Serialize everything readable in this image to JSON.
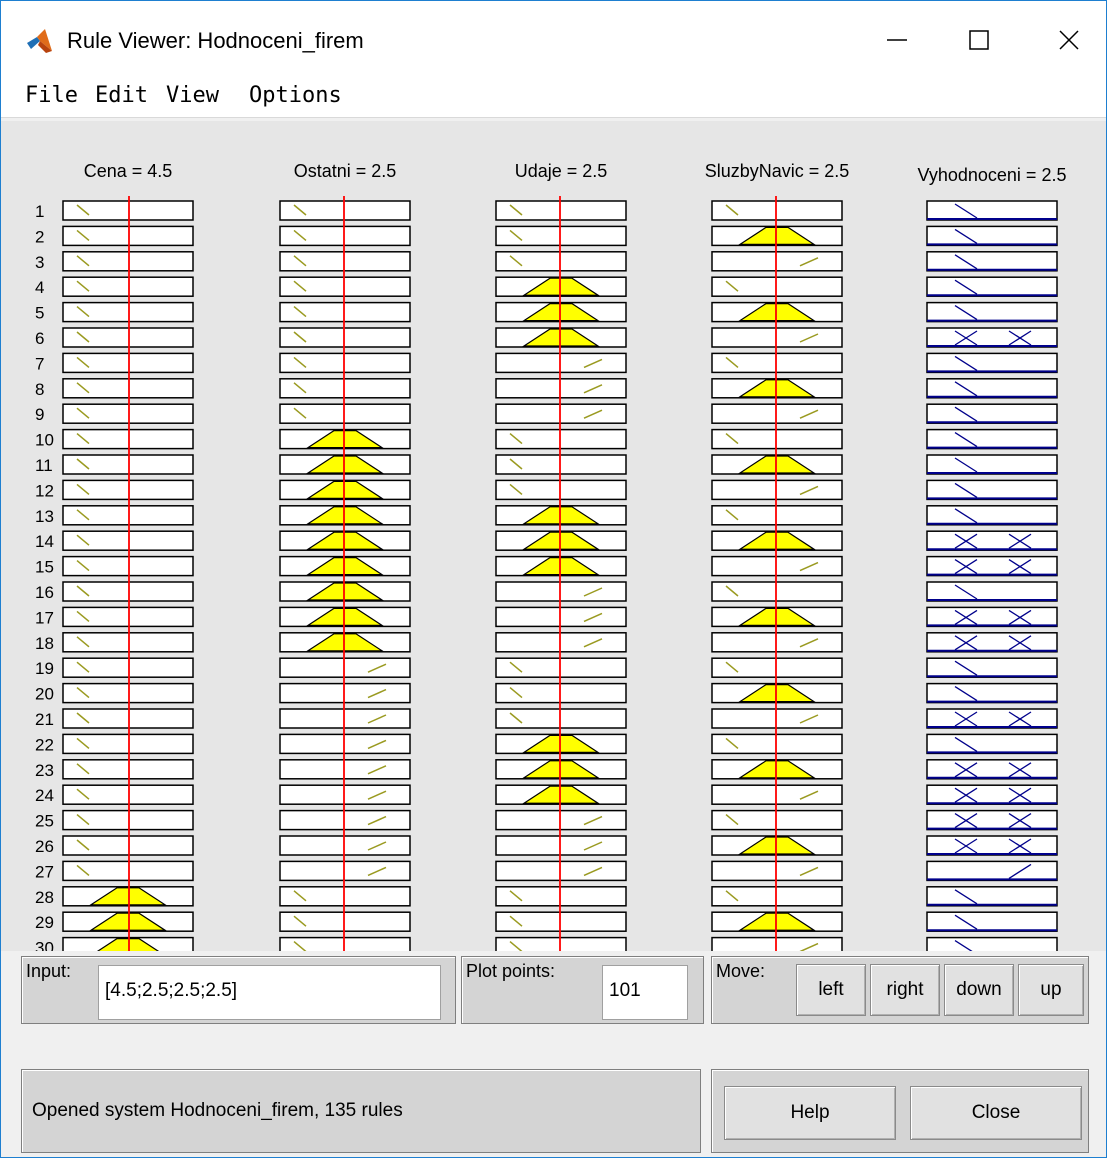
{
  "window": {
    "title": "Rule Viewer: Hodnoceni_firem",
    "controls": {
      "minimize": "minimize-icon",
      "maximize": "maximize-icon",
      "close": "close-icon"
    }
  },
  "menu": [
    "File",
    "Edit",
    "View",
    "Options"
  ],
  "columns": [
    {
      "label": "Cena = 4.5",
      "type": "input"
    },
    {
      "label": "Ostatni = 2.5",
      "type": "input"
    },
    {
      "label": "Udaje = 2.5",
      "type": "input"
    },
    {
      "label": "SluzbyNavic = 2.5",
      "type": "input"
    },
    {
      "label": "Vyhodnoceni = 2.5",
      "type": "output"
    }
  ],
  "rules": [
    {
      "number": "1",
      "mf": [
        "L",
        "L",
        "L",
        "L",
        "L"
      ]
    },
    {
      "number": "2",
      "mf": [
        "L",
        "L",
        "L",
        "M",
        "L"
      ]
    },
    {
      "number": "3",
      "mf": [
        "L",
        "L",
        "L",
        "H",
        "L"
      ]
    },
    {
      "number": "4",
      "mf": [
        "L",
        "L",
        "M",
        "L",
        "L"
      ]
    },
    {
      "number": "5",
      "mf": [
        "L",
        "L",
        "M",
        "M",
        "L"
      ]
    },
    {
      "number": "6",
      "mf": [
        "L",
        "L",
        "M",
        "H",
        "MLH"
      ]
    },
    {
      "number": "7",
      "mf": [
        "L",
        "L",
        "H",
        "L",
        "L"
      ]
    },
    {
      "number": "8",
      "mf": [
        "L",
        "L",
        "H",
        "M",
        "L"
      ]
    },
    {
      "number": "9",
      "mf": [
        "L",
        "L",
        "H",
        "H",
        "L"
      ]
    },
    {
      "number": "10",
      "mf": [
        "L",
        "M",
        "L",
        "L",
        "L"
      ]
    },
    {
      "number": "11",
      "mf": [
        "L",
        "M",
        "L",
        "M",
        "L"
      ]
    },
    {
      "number": "12",
      "mf": [
        "L",
        "M",
        "L",
        "H",
        "L"
      ]
    },
    {
      "number": "13",
      "mf": [
        "L",
        "M",
        "M",
        "L",
        "L"
      ]
    },
    {
      "number": "14",
      "mf": [
        "L",
        "M",
        "M",
        "M",
        "MLH"
      ]
    },
    {
      "number": "15",
      "mf": [
        "L",
        "M",
        "M",
        "H",
        "MLH"
      ]
    },
    {
      "number": "16",
      "mf": [
        "L",
        "M",
        "H",
        "L",
        "L"
      ]
    },
    {
      "number": "17",
      "mf": [
        "L",
        "M",
        "H",
        "M",
        "MLH"
      ]
    },
    {
      "number": "18",
      "mf": [
        "L",
        "M",
        "H",
        "H",
        "MLH"
      ]
    },
    {
      "number": "19",
      "mf": [
        "L",
        "H",
        "L",
        "L",
        "L"
      ]
    },
    {
      "number": "20",
      "mf": [
        "L",
        "H",
        "L",
        "M",
        "L"
      ]
    },
    {
      "number": "21",
      "mf": [
        "L",
        "H",
        "L",
        "H",
        "MLH"
      ]
    },
    {
      "number": "22",
      "mf": [
        "L",
        "H",
        "M",
        "L",
        "L"
      ]
    },
    {
      "number": "23",
      "mf": [
        "L",
        "H",
        "M",
        "M",
        "MLH"
      ]
    },
    {
      "number": "24",
      "mf": [
        "L",
        "H",
        "M",
        "H",
        "MLH"
      ]
    },
    {
      "number": "25",
      "mf": [
        "L",
        "H",
        "H",
        "L",
        "MLH"
      ]
    },
    {
      "number": "26",
      "mf": [
        "L",
        "H",
        "H",
        "M",
        "MLH"
      ]
    },
    {
      "number": "27",
      "mf": [
        "L",
        "H",
        "H",
        "H",
        "H"
      ]
    },
    {
      "number": "28",
      "mf": [
        "M",
        "L",
        "L",
        "L",
        "L"
      ]
    },
    {
      "number": "29",
      "mf": [
        "M",
        "L",
        "L",
        "M",
        "L"
      ]
    },
    {
      "number": "30",
      "mf": [
        "M",
        "L",
        "L",
        "H",
        "L"
      ]
    }
  ],
  "colors": {
    "fill": "#ffff00",
    "input_line": "#9a9a20",
    "output_line": "#00008b",
    "cursor": "#ff0000"
  },
  "input": {
    "label": "Input:",
    "value": "[4.5;2.5;2.5;2.5]"
  },
  "plot_points": {
    "label": "Plot points:",
    "value": "101"
  },
  "move": {
    "label": "Move:",
    "left": "left",
    "right": "right",
    "down": "down",
    "up": "up"
  },
  "status": "Opened system Hodnoceni_firem, 135 rules",
  "buttons": {
    "help": "Help",
    "close": "Close"
  }
}
